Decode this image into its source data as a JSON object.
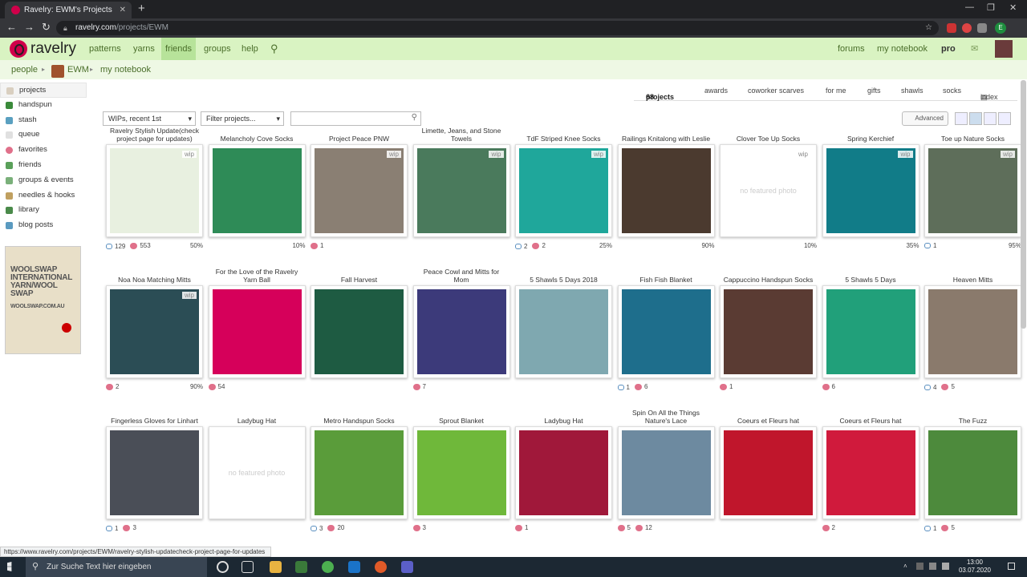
{
  "browser": {
    "tab_title": "Ravelry: EWM's Projects",
    "url_host": "ravelry.com",
    "url_path": "/projects/EWM",
    "status_url": "https://www.ravelry.com/projects/EWM/ravelry-stylish-updatecheck-project-page-for-updates"
  },
  "topnav": {
    "logo": "ravelry",
    "items": [
      "patterns",
      "yarns",
      "friends",
      "groups",
      "help"
    ],
    "right": [
      "forums",
      "my notebook",
      "pro"
    ]
  },
  "subnav": {
    "people": "people",
    "user": "EWM",
    "notebook": "my notebook"
  },
  "sidebar": [
    "projects",
    "handspun",
    "stash",
    "queue",
    "favorites",
    "friends",
    "groups & events",
    "needles & hooks",
    "library",
    "blog posts"
  ],
  "ad": {
    "lines": [
      "WOOLSWAP",
      "INTERNATIONAL",
      "YARN/WOOL",
      "SWAP"
    ],
    "site": "WOOLSWAP.COM.AU"
  },
  "tabs": {
    "projects": "projects",
    "projects_count": "68",
    "items": [
      "awards",
      "coworker scarves",
      "for me",
      "gifts",
      "shawls",
      "socks",
      "index"
    ]
  },
  "filters": {
    "sort": "WIPs, recent 1st",
    "filter": "Filter projects...",
    "advanced": "Advanced"
  },
  "projects": [
    {
      "title": "Ravelry Stylish Update(check project page for updates)",
      "wip": true,
      "comments": "129",
      "hearts": "553",
      "pct": "50%",
      "color": "#e8f0e0"
    },
    {
      "title": "Melancholy Cove Socks",
      "wip": false,
      "comments": "",
      "hearts": "",
      "pct": "10%",
      "color": "#2e8b57"
    },
    {
      "title": "Project Peace PNW",
      "wip": true,
      "comments": "",
      "hearts": "1",
      "pct": "",
      "color": "#8a7f73"
    },
    {
      "title": "Limette, Jeans, and Stone Towels",
      "wip": true,
      "comments": "",
      "hearts": "",
      "pct": "",
      "color": "#4a7a5c"
    },
    {
      "title": "TdF Striped Knee Socks",
      "wip": true,
      "comments": "2",
      "hearts": "2",
      "pct": "25%",
      "color": "#1fa79b"
    },
    {
      "title": "Railings Knitalong with Leslie",
      "wip": false,
      "comments": "",
      "hearts": "",
      "pct": "90%",
      "color": "#4b3a2f"
    },
    {
      "title": "Clover Toe Up Socks",
      "wip": true,
      "comments": "",
      "hearts": "",
      "pct": "10%",
      "nofeat": "no featured photo"
    },
    {
      "title": "Spring Kerchief",
      "wip": true,
      "comments": "",
      "hearts": "",
      "pct": "35%",
      "color": "#117c88"
    },
    {
      "title": "Toe up Nature Socks",
      "wip": true,
      "comments": "1",
      "hearts": "",
      "pct": "95%",
      "color": "#5e6e5a"
    },
    {
      "title": "Noa Noa Matching Mitts",
      "wip": true,
      "comments": "",
      "hearts": "2",
      "pct": "90%",
      "color": "#2b4d55"
    },
    {
      "title": "For the Love of the Ravelry Yarn Ball",
      "wip": false,
      "comments": "",
      "hearts": "54",
      "pct": "",
      "color": "#d6005a"
    },
    {
      "title": "Fall Harvest",
      "wip": false,
      "comments": "",
      "hearts": "",
      "pct": "",
      "color": "#1e5b42"
    },
    {
      "title": "Peace Cowl and Mitts for Mom",
      "wip": false,
      "comments": "",
      "hearts": "7",
      "pct": "",
      "color": "#3c3a7a"
    },
    {
      "title": "5 Shawls 5 Days 2018",
      "wip": false,
      "comments": "",
      "hearts": "",
      "pct": "",
      "color": "#7fa8b0"
    },
    {
      "title": "Fish Fish Blanket",
      "wip": false,
      "comments": "1",
      "hearts": "6",
      "pct": "",
      "color": "#1e6e8c"
    },
    {
      "title": "Cappuccino Handspun Socks",
      "wip": false,
      "comments": "",
      "hearts": "1",
      "pct": "",
      "color": "#5a3b33"
    },
    {
      "title": "5 Shawls 5 Days",
      "wip": false,
      "comments": "",
      "hearts": "6",
      "pct": "",
      "color": "#21a07a"
    },
    {
      "title": "Heaven Mitts",
      "wip": false,
      "comments": "4",
      "hearts": "5",
      "pct": "",
      "color": "#8a7a6c"
    },
    {
      "title": "Fingerless Gloves for Linhart",
      "wip": false,
      "comments": "1",
      "hearts": "3",
      "pct": "",
      "color": "#4a4e57"
    },
    {
      "title": "Ladybug Hat",
      "wip": false,
      "comments": "",
      "hearts": "",
      "pct": "",
      "nofeat": "no featured photo"
    },
    {
      "title": "Metro Handspun Socks",
      "wip": false,
      "comments": "3",
      "hearts": "20",
      "pct": "",
      "color": "#5a9c3a"
    },
    {
      "title": "Sprout Blanket",
      "wip": false,
      "comments": "",
      "hearts": "3",
      "pct": "",
      "color": "#6fb83a"
    },
    {
      "title": "Ladybug Hat",
      "wip": false,
      "comments": "",
      "hearts": "1",
      "pct": "",
      "color": "#a0183a"
    },
    {
      "title": "Spin On All the Things Nature's Lace",
      "wip": false,
      "comments": "",
      "hearts": "5",
      "hearts2": "12",
      "pct": "",
      "color": "#6d8aa0"
    },
    {
      "title": "Coeurs et Fleurs hat",
      "wip": false,
      "comments": "",
      "hearts": "",
      "pct": "",
      "color": "#c0162c"
    },
    {
      "title": "Coeurs et Fleurs hat",
      "wip": false,
      "comments": "",
      "hearts": "2",
      "pct": "",
      "color": "#d01a3c"
    },
    {
      "title": "The Fuzz",
      "wip": false,
      "comments": "1",
      "hearts": "5",
      "pct": "",
      "color": "#4d8a3c"
    }
  ],
  "taskbar": {
    "search": "Zur Suche Text hier eingeben",
    "time": "13:00",
    "date": "03.07.2020"
  },
  "wip_label": "wip"
}
